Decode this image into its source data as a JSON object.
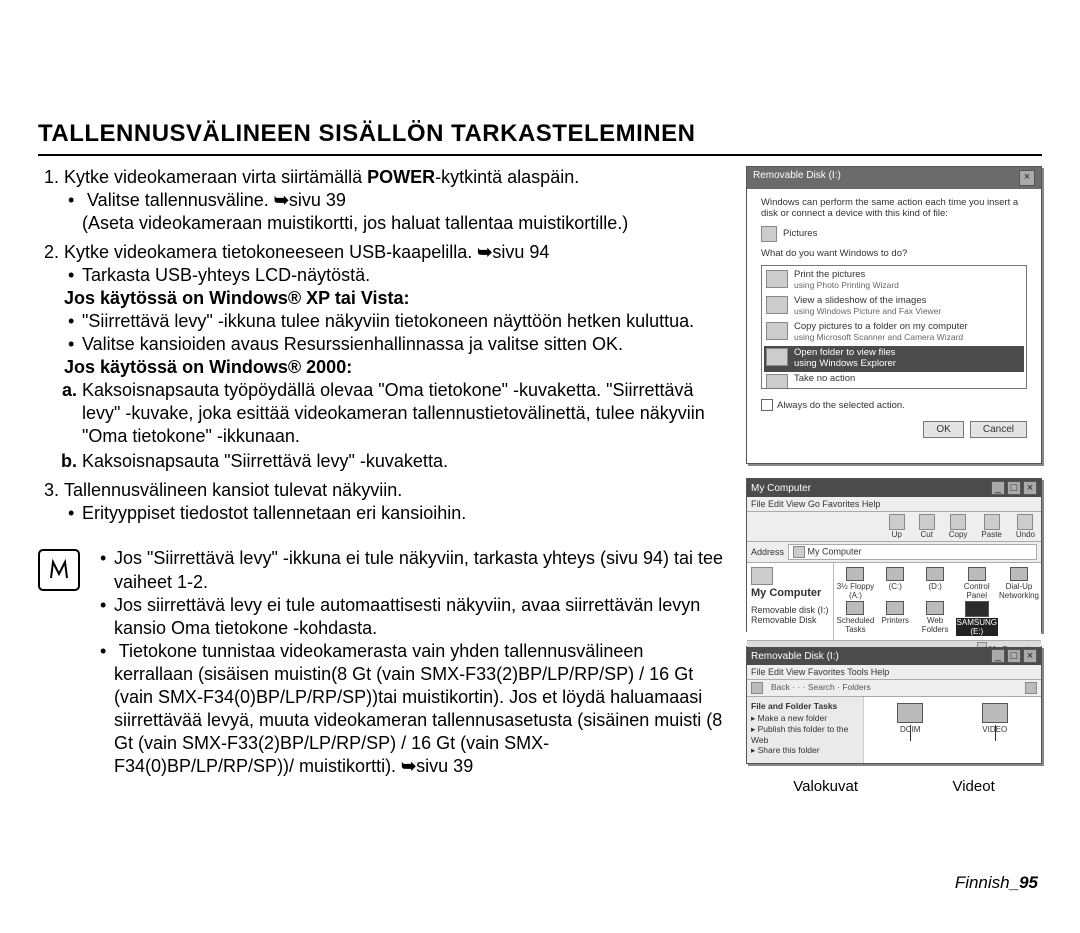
{
  "heading": "TALLENNUSVÄLINEEN SISÄLLÖN TARKASTELEMINEN",
  "step1": {
    "pre": "Kytke videokameraan virta siirtämällä ",
    "bold": "POWER",
    "post": "-kytkintä alaspäin.",
    "b1": "Valitse tallennusväline.",
    "b1page": "sivu 39",
    "b1paren": "(Aseta videokameraan muistikortti, jos haluat tallentaa muistikortille.)"
  },
  "step2": {
    "text": "Kytke videokamera tietokoneeseen USB-kaapelilla.",
    "page": "sivu 94",
    "b1": "Tarkasta USB-yhteys LCD-näytöstä.",
    "xp_head": "Jos käytössä on Windows® XP tai Vista:",
    "xp_b1": "\"Siirrettävä levy\" -ikkuna tulee näkyviin tietokoneen näyttöön hetken kuluttua.",
    "xp_b2": "Valitse kansioiden avaus Resurssienhallinnassa ja valitse sitten OK.",
    "w2k_head": "Jos käytössä on Windows® 2000:",
    "a": "Kaksoisnapsauta työpöydällä olevaa \"Oma tietokone\" -kuvaketta. \"Siirrettävä levy\" -kuvake, joka esittää videokameran tallennustietovälinettä, tulee näkyviin \"Oma tietokone\" -ikkunaan.",
    "b": "Kaksoisnapsauta \"Siirrettävä levy\" -kuvaketta."
  },
  "step3": {
    "text": "Tallennusvälineen kansiot tulevat näkyviin.",
    "b1": "Erityyppiset tiedostot tallennetaan eri kansioihin."
  },
  "notes": {
    "n1": "Jos \"Siirrettävä levy\" -ikkuna ei tule näkyviin, tarkasta yhteys (sivu 94) tai tee vaiheet 1-2.",
    "n2": "Jos siirrettävä levy ei tule automaattisesti näkyviin, avaa siirrettävän levyn kansio Oma tietokone -kohdasta.",
    "n3a": "Tietokone tunnistaa videokamerasta vain yhden tallennusvälineen kerrallaan (sisäisen muistin(8 Gt (vain SMX-F33(2)BP/LP/RP/SP) / 16 Gt (vain SMX-F34(0)BP/LP/RP/SP))tai muistikortin). Jos et löydä haluamaasi siirrettävää levyä, muuta videokameran tallennusasetusta (sisäinen muisti (8 Gt (vain SMX-F33(2)BP/LP/RP/SP) / 16 Gt (vain SMX-F34(0)BP/LP/RP/SP))/ muistikortti).",
    "n3page": "sivu 39"
  },
  "dlg": {
    "title": "Removable Disk (I:)",
    "desc": "Windows can perform the same action each time you insert a disk or connect a device with this kind of file:",
    "media": "Pictures",
    "prompt": "What do you want Windows to do?",
    "opt1a": "Print the pictures",
    "opt1b": "using Photo Printing Wizard",
    "opt2a": "View a slideshow of the images",
    "opt2b": "using Windows Picture and Fax Viewer",
    "opt3a": "Copy pictures to a folder on my computer",
    "opt3b": "using Microsoft Scanner and Camera Wizard",
    "opt4a": "Open folder to view files",
    "opt4b": "using Windows Explorer",
    "opt5": "Take no action",
    "always": "Always do the selected action.",
    "ok": "OK",
    "cancel": "Cancel"
  },
  "myc": {
    "title": "My Computer",
    "menu": "File   Edit   View   Go   Favorites   Help",
    "tools": [
      "Up",
      "Cut",
      "Copy",
      "Paste",
      "Undo"
    ],
    "addr_label": "Address",
    "addr_value": "My Computer",
    "left_head": "My Computer",
    "left_sub1": "Removable disk (I:)",
    "left_sub2": "Removable Disk",
    "icons": [
      "3½ Floppy (A:)",
      "(C:)",
      "(D:)",
      "Control Panel",
      "Dial-Up Networking",
      "Scheduled Tasks",
      "Printers",
      "Web Folders",
      "SAMSUNG (E:)"
    ],
    "status": "My Computer"
  },
  "rem": {
    "title": "Removable Disk (I:)",
    "menu": "File   Edit   View   Favorites   Tools   Help",
    "tb": "Back ·  ·  · Search · Folders",
    "panel_head": "File and Folder Tasks",
    "panel_i1": "Make a new folder",
    "panel_i2": "Publish this folder to the Web",
    "panel_i3": "Share this folder",
    "f1": "DCIM",
    "f2": "VIDEO"
  },
  "caps": {
    "c1": "Valokuvat",
    "c2": "Videot"
  },
  "footer": {
    "lang": "Finnish",
    "num": "_95"
  }
}
